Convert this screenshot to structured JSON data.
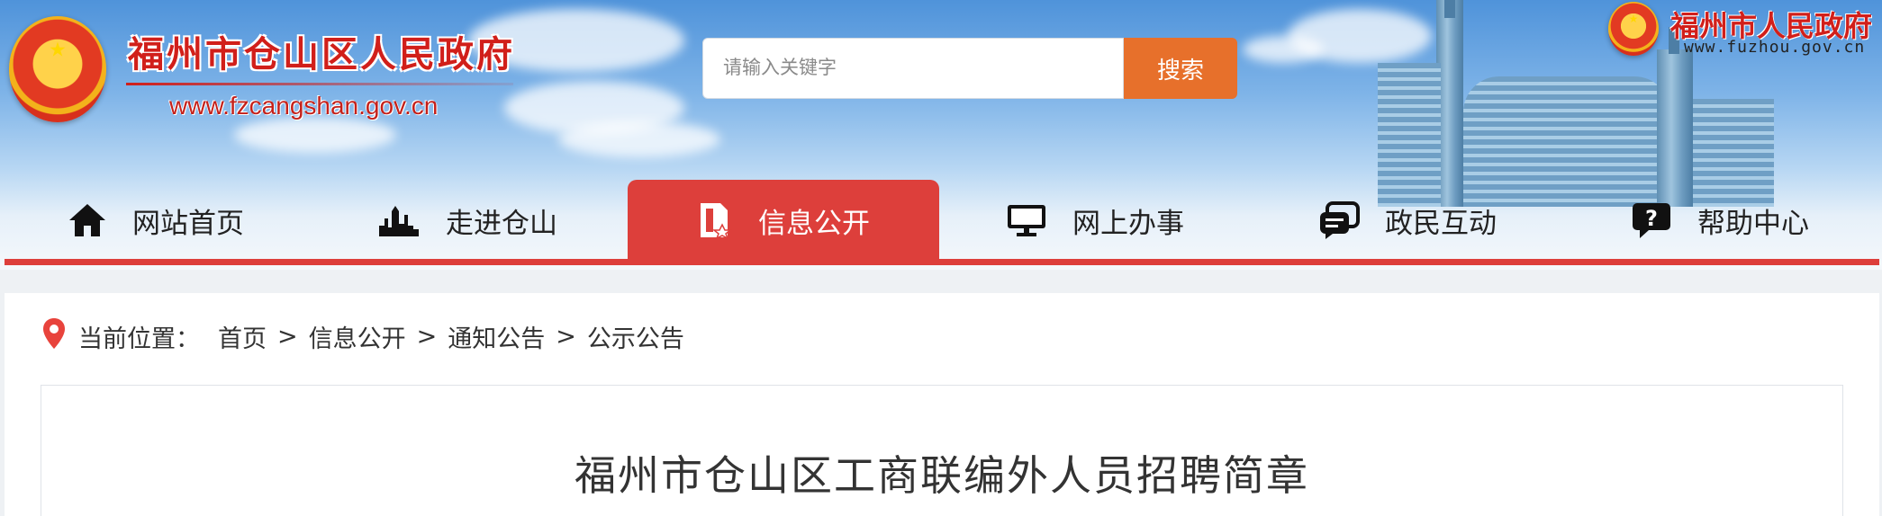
{
  "header": {
    "site_title": "福州市仓山区人民政府",
    "site_domain": "www.fzcangshan.gov.cn",
    "search": {
      "placeholder": "请输入关键字",
      "button_label": "搜索"
    },
    "parent_site": {
      "title": "福州市人民政府",
      "domain": "www.fuzhou.gov.cn"
    }
  },
  "nav": {
    "items": [
      {
        "label": "网站首页",
        "icon": "home-icon",
        "active": false
      },
      {
        "label": "走进仓山",
        "icon": "skyline-icon",
        "active": false
      },
      {
        "label": "信息公开",
        "icon": "document-icon",
        "active": true
      },
      {
        "label": "网上办事",
        "icon": "monitor-icon",
        "active": false
      },
      {
        "label": "政民互动",
        "icon": "chat-icon",
        "active": false
      },
      {
        "label": "帮助中心",
        "icon": "help-icon",
        "active": false
      }
    ]
  },
  "breadcrumb": {
    "prefix": "当前位置：",
    "separator": ">",
    "items": [
      "首页",
      "信息公开",
      "通知公告",
      "公示公告"
    ]
  },
  "article": {
    "title": "福州市仓山区工商联编外人员招聘简章"
  },
  "colors": {
    "brand_red": "#dd3f3b",
    "title_red": "#d11f1a",
    "search_orange": "#e7702b"
  }
}
